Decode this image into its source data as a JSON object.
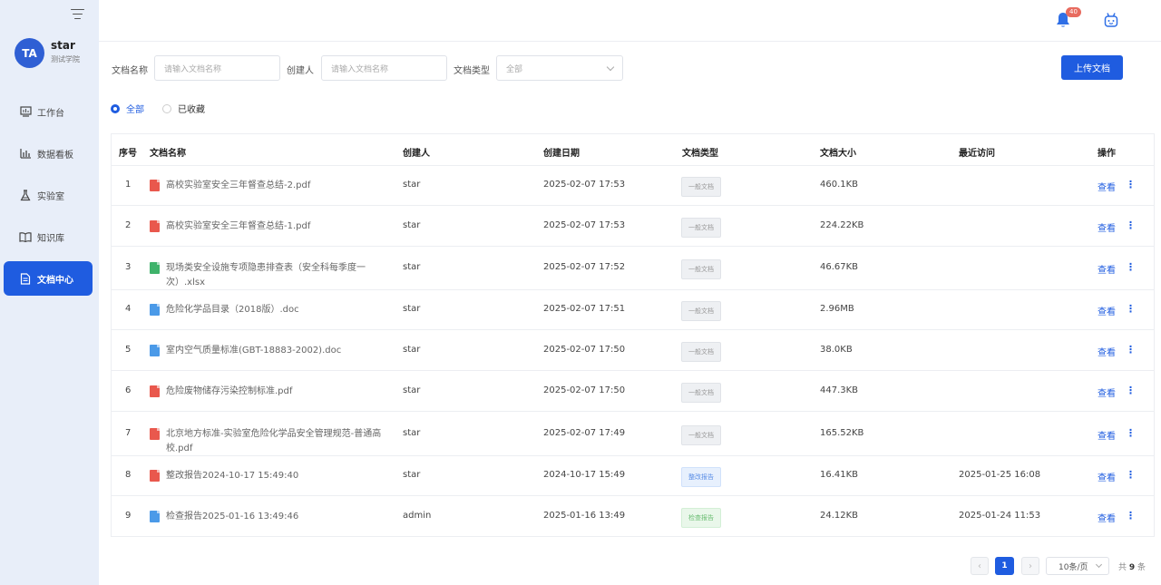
{
  "user": {
    "avatar": "TA",
    "name": "star",
    "org": "测试学院"
  },
  "nav": [
    {
      "label": "工作台",
      "icon": "monitor-icon"
    },
    {
      "label": "数据看板",
      "icon": "bar-chart-icon"
    },
    {
      "label": "实验室",
      "icon": "flask-icon"
    },
    {
      "label": "知识库",
      "icon": "book-icon"
    },
    {
      "label": "文档中心",
      "icon": "document-icon",
      "active": true
    }
  ],
  "header": {
    "notification_count": "40"
  },
  "filters": {
    "name_label": "文档名称",
    "name_placeholder": "请输入文档名称",
    "creator_label": "创建人",
    "creator_placeholder": "请输入文档名称",
    "type_label": "文档类型",
    "type_value": "全部",
    "upload_label": "上传文档"
  },
  "radios": {
    "all": "全部",
    "favorites": "已收藏"
  },
  "table": {
    "headers": {
      "index": "序号",
      "name": "文档名称",
      "creator": "创建人",
      "created": "创建日期",
      "type": "文档类型",
      "size": "文档大小",
      "visited": "最近访问",
      "action": "操作"
    },
    "action_label": "查看",
    "rows": [
      {
        "index": "1",
        "name": "高校实验室安全三年督查总结-2.pdf",
        "ftype": "pdf",
        "creator": "star",
        "created": "2025-02-07 17:53",
        "type": "一般文档",
        "tag": "general",
        "size": "460.1KB",
        "visited": ""
      },
      {
        "index": "2",
        "name": "高校实验室安全三年督查总结-1.pdf",
        "ftype": "pdf",
        "creator": "star",
        "created": "2025-02-07 17:53",
        "type": "一般文档",
        "tag": "general",
        "size": "224.22KB",
        "visited": ""
      },
      {
        "index": "3",
        "name": "现场类安全设施专项隐患排查表（安全科每季度一次）.xlsx",
        "ftype": "xls",
        "creator": "star",
        "created": "2025-02-07 17:52",
        "type": "一般文档",
        "tag": "general",
        "size": "46.67KB",
        "visited": ""
      },
      {
        "index": "4",
        "name": "危险化学品目录（2018版）.doc",
        "ftype": "doc",
        "creator": "star",
        "created": "2025-02-07 17:51",
        "type": "一般文档",
        "tag": "general",
        "size": "2.96MB",
        "visited": ""
      },
      {
        "index": "5",
        "name": "室内空气质量标准(GBT-18883-2002).doc",
        "ftype": "doc",
        "creator": "star",
        "created": "2025-02-07 17:50",
        "type": "一般文档",
        "tag": "general",
        "size": "38.0KB",
        "visited": ""
      },
      {
        "index": "6",
        "name": "危险废物储存污染控制标准.pdf",
        "ftype": "pdf",
        "creator": "star",
        "created": "2025-02-07 17:50",
        "type": "一般文档",
        "tag": "general",
        "size": "447.3KB",
        "visited": ""
      },
      {
        "index": "7",
        "name": "北京地方标准-实验室危险化学品安全管理规范-普通高校.pdf",
        "ftype": "pdf",
        "creator": "star",
        "created": "2025-02-07 17:49",
        "type": "一般文档",
        "tag": "general",
        "size": "165.52KB",
        "visited": ""
      },
      {
        "index": "8",
        "name": "整改报告2024-10-17 15:49:40",
        "ftype": "pdf",
        "creator": "star",
        "created": "2024-10-17 15:49",
        "type": "整改报告",
        "tag": "rectify",
        "size": "16.41KB",
        "visited": "2025-01-25 16:08"
      },
      {
        "index": "9",
        "name": "检查报告2025-01-16 13:49:46",
        "ftype": "doc",
        "creator": "admin",
        "created": "2025-01-16 13:49",
        "type": "检查报告",
        "tag": "check",
        "size": "24.12KB",
        "visited": "2025-01-24 11:53"
      }
    ]
  },
  "pagination": {
    "current": "1",
    "page_size": "10条/页",
    "total_prefix": "共",
    "total": "9",
    "total_suffix": "条"
  }
}
